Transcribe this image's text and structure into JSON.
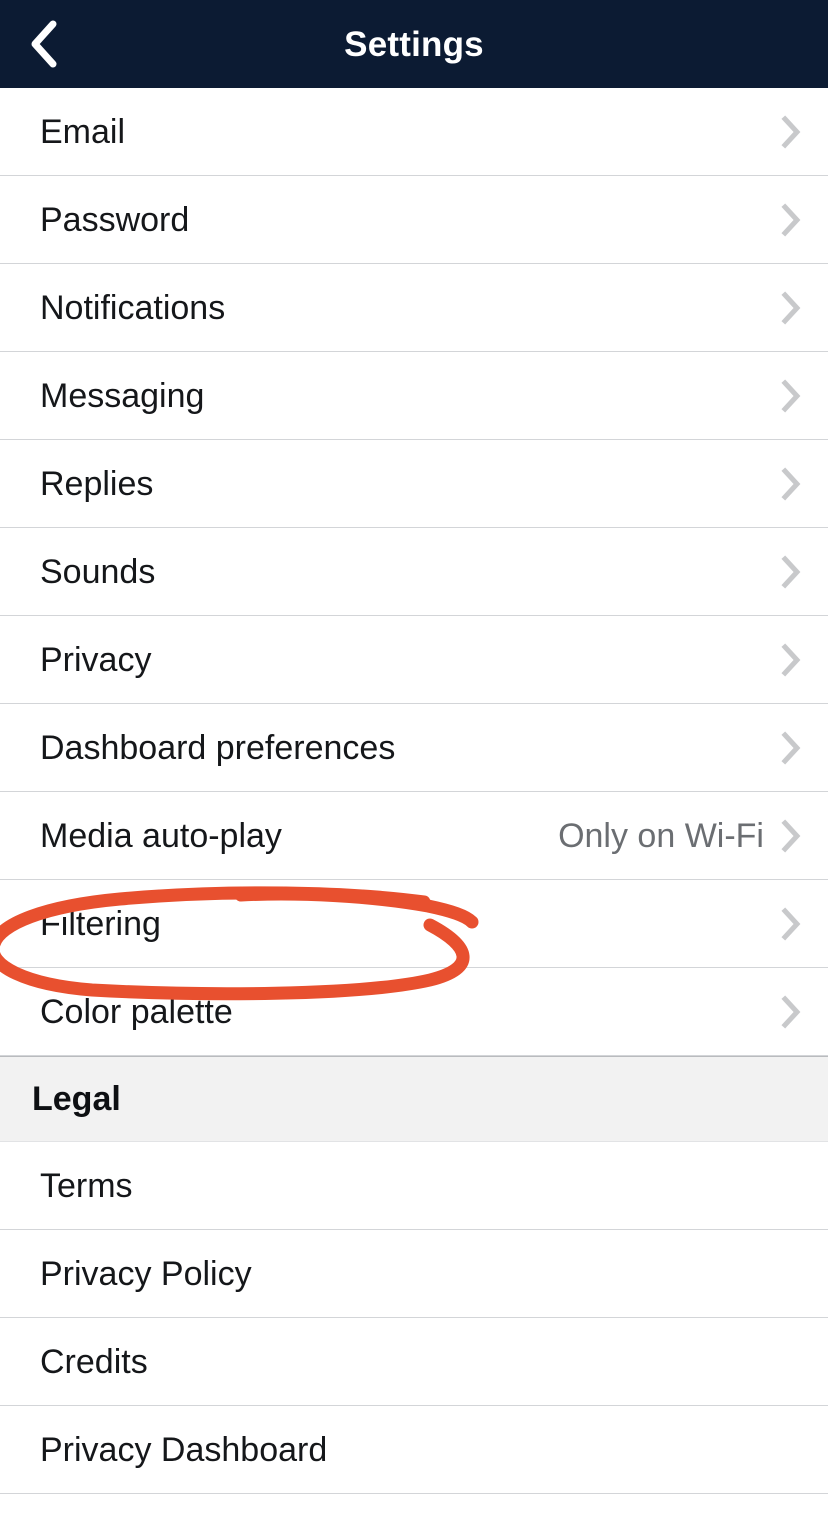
{
  "header": {
    "title": "Settings",
    "back_icon": "chevron-left-icon",
    "background_color": "#0c1b33",
    "title_color": "#ffffff"
  },
  "sections": [
    {
      "id": "general",
      "header": null,
      "rows": [
        {
          "label": "Email",
          "value": "",
          "chevron": true
        },
        {
          "label": "Password",
          "value": "",
          "chevron": true
        },
        {
          "label": "Notifications",
          "value": "",
          "chevron": true
        },
        {
          "label": "Messaging",
          "value": "",
          "chevron": true
        },
        {
          "label": "Replies",
          "value": "",
          "chevron": true
        },
        {
          "label": "Sounds",
          "value": "",
          "chevron": true
        },
        {
          "label": "Privacy",
          "value": "",
          "chevron": true
        },
        {
          "label": "Dashboard preferences",
          "value": "",
          "chevron": true
        },
        {
          "label": "Media auto-play",
          "value": "Only on Wi-Fi",
          "chevron": true
        },
        {
          "label": "Filtering",
          "value": "",
          "chevron": true
        },
        {
          "label": "Color palette",
          "value": "",
          "chevron": true
        }
      ]
    },
    {
      "id": "legal",
      "header": "Legal",
      "rows": [
        {
          "label": "Terms",
          "value": "",
          "chevron": false
        },
        {
          "label": "Privacy Policy",
          "value": "",
          "chevron": false
        },
        {
          "label": "Credits",
          "value": "",
          "chevron": false
        },
        {
          "label": "Privacy Dashboard",
          "value": "",
          "chevron": false
        }
      ]
    }
  ],
  "annotation": {
    "type": "hand-drawn-ellipse",
    "target_label": "Filtering",
    "color": "#e8502f",
    "stroke_width": 13
  },
  "colors": {
    "navbar": "#0c1b33",
    "row_background": "#ffffff",
    "divider": "#d3d5d8",
    "section_band": "#f2f2f2",
    "primary_text": "#15171a",
    "secondary_text": "#6b6e72",
    "chevron": "#c8c9cb",
    "annotation": "#e8502f"
  }
}
